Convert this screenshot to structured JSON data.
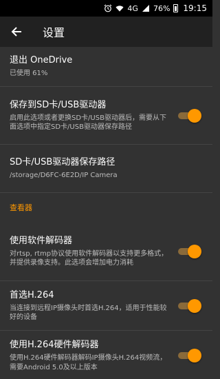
{
  "status": {
    "network": "4G",
    "battery": "76%",
    "time": "19:15",
    "icons": [
      "alarm-icon",
      "wifi-icon",
      "signal-icon",
      "battery-icon"
    ]
  },
  "appbar": {
    "title": "设置",
    "back_icon": "arrow-left-icon"
  },
  "items": [
    {
      "title": "退出 OneDrive",
      "subtitle": "已使用 61%"
    },
    {
      "title": "保存到SD卡/USB驱动器",
      "subtitle": "启用此选项或者更换SD卡/USB驱动器后，需要从下面选项中指定SD卡/USB驱动器保存路径",
      "toggle": true
    },
    {
      "title": "SD卡/USB驱动器保存路径",
      "subtitle": "/storage/D6FC-6E2D/IP Camera"
    }
  ],
  "section": {
    "label": "查看器"
  },
  "viewer_items": [
    {
      "title": "使用软件解码器",
      "subtitle": "对rtsp, rtmp协议使用软件解码器以支持更多格式，并提供录像支持。此选项会增加电力消耗",
      "toggle": true
    },
    {
      "title": "首选H.264",
      "subtitle": "当连接到远程IP摄像头时首选H.264，适用于性能较好的设备",
      "toggle": true
    },
    {
      "title": "使用H.264硬件解码器",
      "subtitle": "使用H.264硬件解码器解码IP摄像头H.264视频流，需要Android 5.0及以上版本",
      "toggle": true
    }
  ],
  "colors": {
    "accent": "#ff9800",
    "background": "#323232",
    "appbar": "#212121"
  }
}
